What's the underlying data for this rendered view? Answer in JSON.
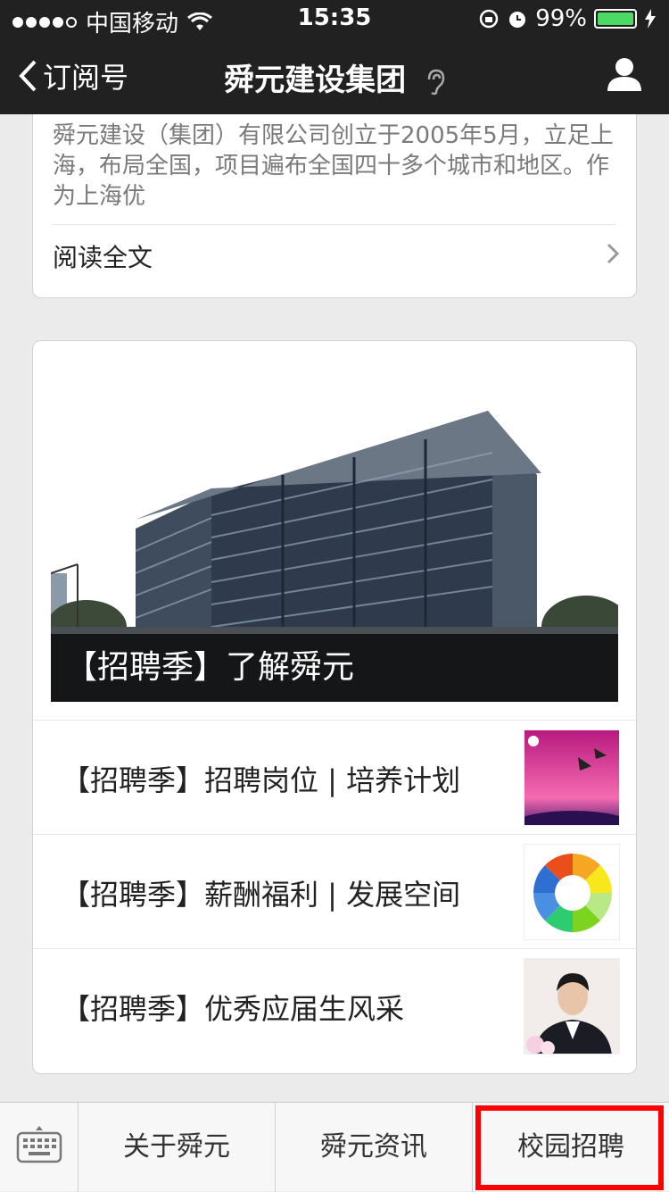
{
  "status_bar": {
    "carrier": "中国移动",
    "time": "15:35",
    "battery": "99%",
    "battery_level": 0.99
  },
  "nav": {
    "back_label": "订阅号",
    "title": "舜元建设集团"
  },
  "intro_card": {
    "text": "舜元建设（集团）有限公司创立于2005年5月，立足上海，布局全国，项目遍布全国四十多个城市和地区。作为上海优",
    "read_all": "阅读全文"
  },
  "news_card": {
    "hero_title": "【招聘季】了解舜元",
    "articles": [
      {
        "title": "【招聘季】招聘岗位 | 培养计划",
        "thumb": "kite-sunset-image"
      },
      {
        "title": "【招聘季】薪酬福利 | 发展空间",
        "thumb": "color-wheel-image"
      },
      {
        "title": "【招聘季】优秀应届生风采",
        "thumb": "graduate-portrait-image"
      }
    ]
  },
  "bottom_menu": {
    "keyboard_icon": "keyboard-icon",
    "items": [
      "关于舜元",
      "舜元资讯",
      "校园招聘"
    ],
    "highlight_color": "#ff0000"
  }
}
